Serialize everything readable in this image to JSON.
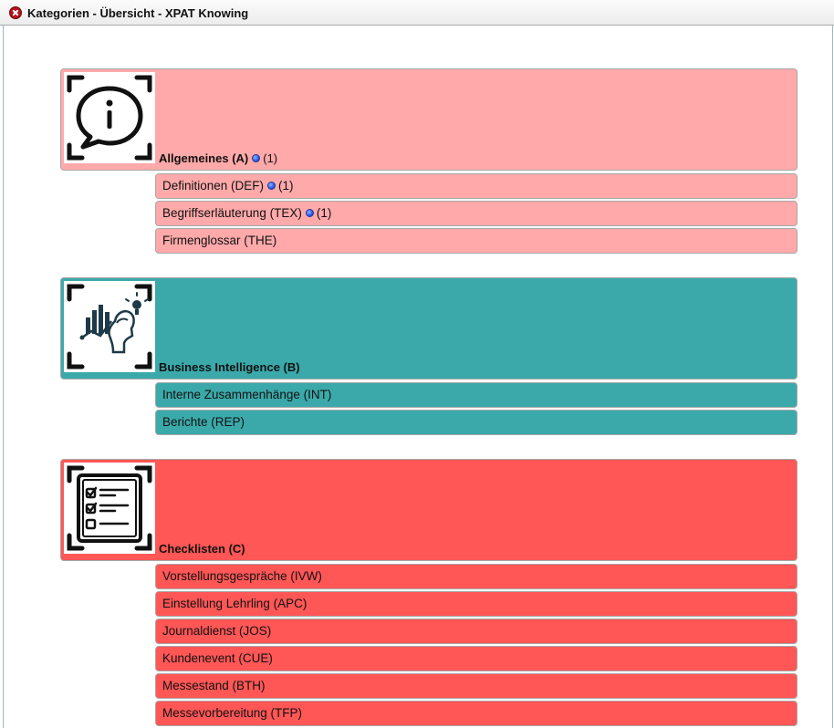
{
  "window": {
    "title": "Kategorien - Übersicht - XPAT Knowing"
  },
  "colors": {
    "allgemeines": "#ffa9aa",
    "business": "#3ba9aa",
    "checklisten": "#ff5656",
    "badge_dot": "#1f4fe0"
  },
  "categories": [
    {
      "title": "Allgemeines (A)",
      "badge_count": "(1)",
      "icon": "info-speech-bubble-icon",
      "items": [
        {
          "label": "Definitionen (DEF)",
          "badge_count": "(1)"
        },
        {
          "label": "Begriffserläuterung (TEX)",
          "badge_count": "(1)"
        },
        {
          "label": "Firmenglossar (THE)"
        }
      ]
    },
    {
      "title": "Business Intelligence (B)",
      "icon": "business-intelligence-icon",
      "items": [
        {
          "label": "Interne Zusammenhänge (INT)"
        },
        {
          "label": "Berichte (REP)"
        }
      ]
    },
    {
      "title": "Checklisten (C)",
      "icon": "checklist-icon",
      "items": [
        {
          "label": "Vorstellungsgespräche (IVW)"
        },
        {
          "label": "Einstellung Lehrling (APC)"
        },
        {
          "label": "Journaldienst (JOS)"
        },
        {
          "label": "Kundenevent (CUE)"
        },
        {
          "label": "Messestand (BTH)"
        },
        {
          "label": "Messevorbereitung (TFP)"
        }
      ]
    }
  ]
}
